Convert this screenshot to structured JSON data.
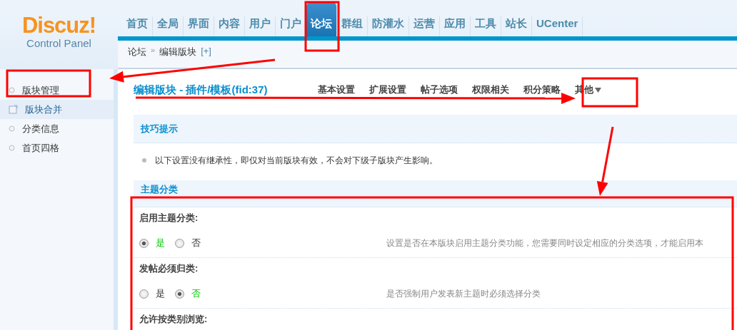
{
  "logo": {
    "name": "Discuz!",
    "subtitle": "Control Panel"
  },
  "nav": [
    {
      "label": "首页",
      "selected": false
    },
    {
      "label": "全局",
      "selected": false
    },
    {
      "label": "界面",
      "selected": false
    },
    {
      "label": "内容",
      "selected": false
    },
    {
      "label": "用户",
      "selected": false
    },
    {
      "label": "门户",
      "selected": false
    },
    {
      "label": "论坛",
      "selected": true
    },
    {
      "label": "群组",
      "selected": false
    },
    {
      "label": "防灌水",
      "selected": false
    },
    {
      "label": "运营",
      "selected": false
    },
    {
      "label": "应用",
      "selected": false
    },
    {
      "label": "工具",
      "selected": false
    },
    {
      "label": "站长",
      "selected": false
    },
    {
      "label": "UCenter",
      "selected": false
    }
  ],
  "breadcrumb": {
    "items": [
      "论坛",
      "编辑版块"
    ],
    "separator": "»",
    "toggle": "[+]"
  },
  "sidebar": {
    "items": [
      {
        "label": "版块管理",
        "selected": false
      },
      {
        "label": "版块合并",
        "selected": true
      },
      {
        "label": "分类信息",
        "selected": false
      },
      {
        "label": "首页四格",
        "selected": false
      }
    ]
  },
  "page_title": "编辑版块 - 插件/模板(fid:37)",
  "tabs": [
    {
      "label": "基本设置",
      "dropdown": false
    },
    {
      "label": "扩展设置",
      "dropdown": false
    },
    {
      "label": "帖子选项",
      "dropdown": false
    },
    {
      "label": "权限相关",
      "dropdown": false
    },
    {
      "label": "积分策略",
      "dropdown": false
    },
    {
      "label": "其他",
      "dropdown": true
    }
  ],
  "tips": {
    "title": "技巧提示",
    "items": [
      "以下设置没有继承性，即仅对当前版块有效，不会对下级子版块产生影响。"
    ]
  },
  "section": {
    "title": "主题分类",
    "settings": [
      {
        "label": "启用主题分类:",
        "options": [
          {
            "label": "是",
            "checked": true
          },
          {
            "label": "否",
            "checked": false
          }
        ],
        "hint": "设置是否在本版块启用主题分类功能，您需要同时设定相应的分类选项，才能启用本"
      },
      {
        "label": "发帖必须归类:",
        "options": [
          {
            "label": "是",
            "checked": false
          },
          {
            "label": "否",
            "checked": true
          }
        ],
        "hint": "是否强制用户发表新主题时必须选择分类"
      },
      {
        "label": "允许按类别浏览:"
      }
    ]
  }
}
